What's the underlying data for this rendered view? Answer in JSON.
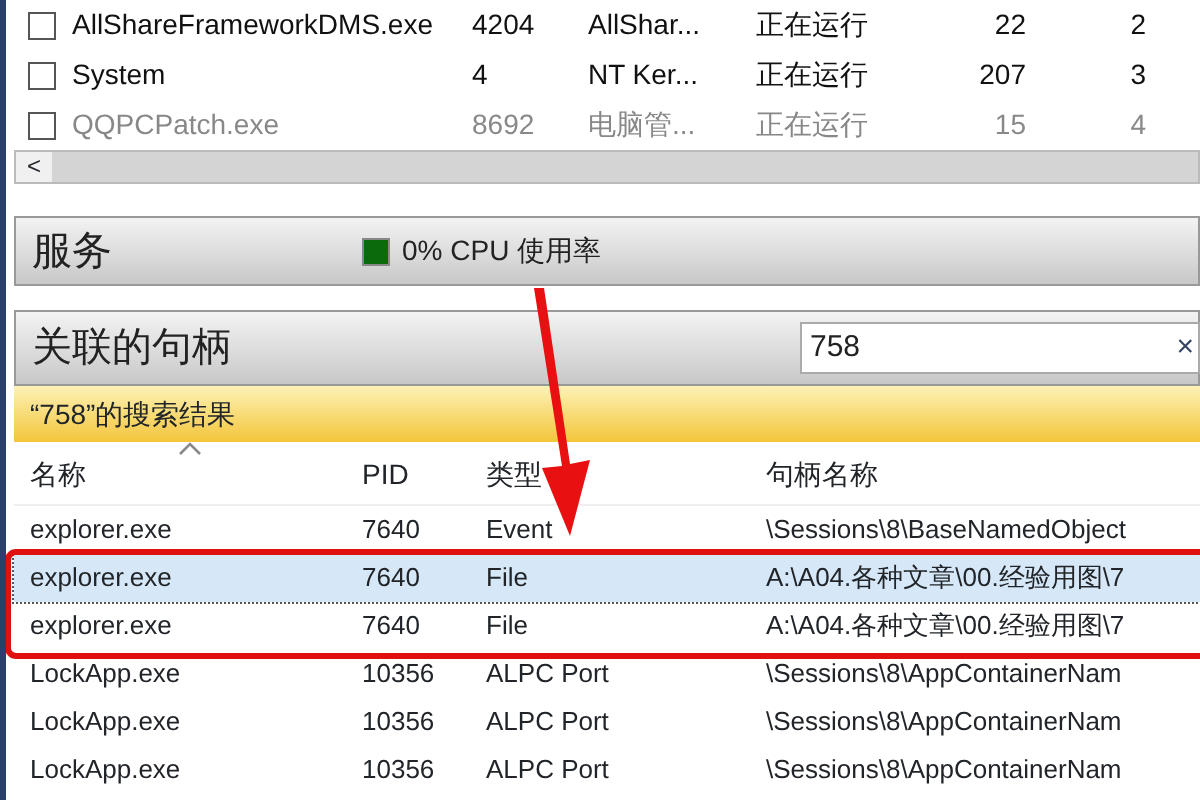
{
  "processes": {
    "rows": [
      {
        "checked": false,
        "dimmed": false,
        "name": "AllShareFrameworkDMS.exe",
        "pid": "4204",
        "description": "AllShar...",
        "status": "正在运行",
        "threads": "22",
        "cpu": "2"
      },
      {
        "checked": false,
        "dimmed": false,
        "name": "System",
        "pid": "4",
        "description": "NT Ker...",
        "status": "正在运行",
        "threads": "207",
        "cpu": "3"
      },
      {
        "checked": false,
        "dimmed": true,
        "name": "QQPCPatch.exe",
        "pid": "8692",
        "description": "电脑管...",
        "status": "正在运行",
        "threads": "15",
        "cpu": "4"
      }
    ],
    "scroll_left": "<"
  },
  "services": {
    "title": "服务",
    "cpu_usage": "0% CPU 使用率"
  },
  "handles": {
    "title": "关联的句柄",
    "search": {
      "value": "758",
      "clear": "×"
    },
    "results_title": "“758”的搜索结果",
    "columns": [
      "名称",
      "PID",
      "类型",
      "句柄名称"
    ],
    "rows": [
      {
        "selected": false,
        "name": "explorer.exe",
        "pid": "7640",
        "type": "Event",
        "handle": "\\Sessions\\8\\BaseNamedObject"
      },
      {
        "selected": true,
        "name": "explorer.exe",
        "pid": "7640",
        "type": "File",
        "handle": "A:\\A04.各种文章\\00.经验用图\\7"
      },
      {
        "selected": false,
        "name": "explorer.exe",
        "pid": "7640",
        "type": "File",
        "handle": "A:\\A04.各种文章\\00.经验用图\\7"
      },
      {
        "selected": false,
        "name": "LockApp.exe",
        "pid": "10356",
        "type": "ALPC Port",
        "handle": "\\Sessions\\8\\AppContainerNam"
      },
      {
        "selected": false,
        "name": "LockApp.exe",
        "pid": "10356",
        "type": "ALPC Port",
        "handle": "\\Sessions\\8\\AppContainerNam"
      },
      {
        "selected": false,
        "name": "LockApp.exe",
        "pid": "10356",
        "type": "ALPC Port",
        "handle": "\\Sessions\\8\\AppContainerNam"
      }
    ]
  }
}
